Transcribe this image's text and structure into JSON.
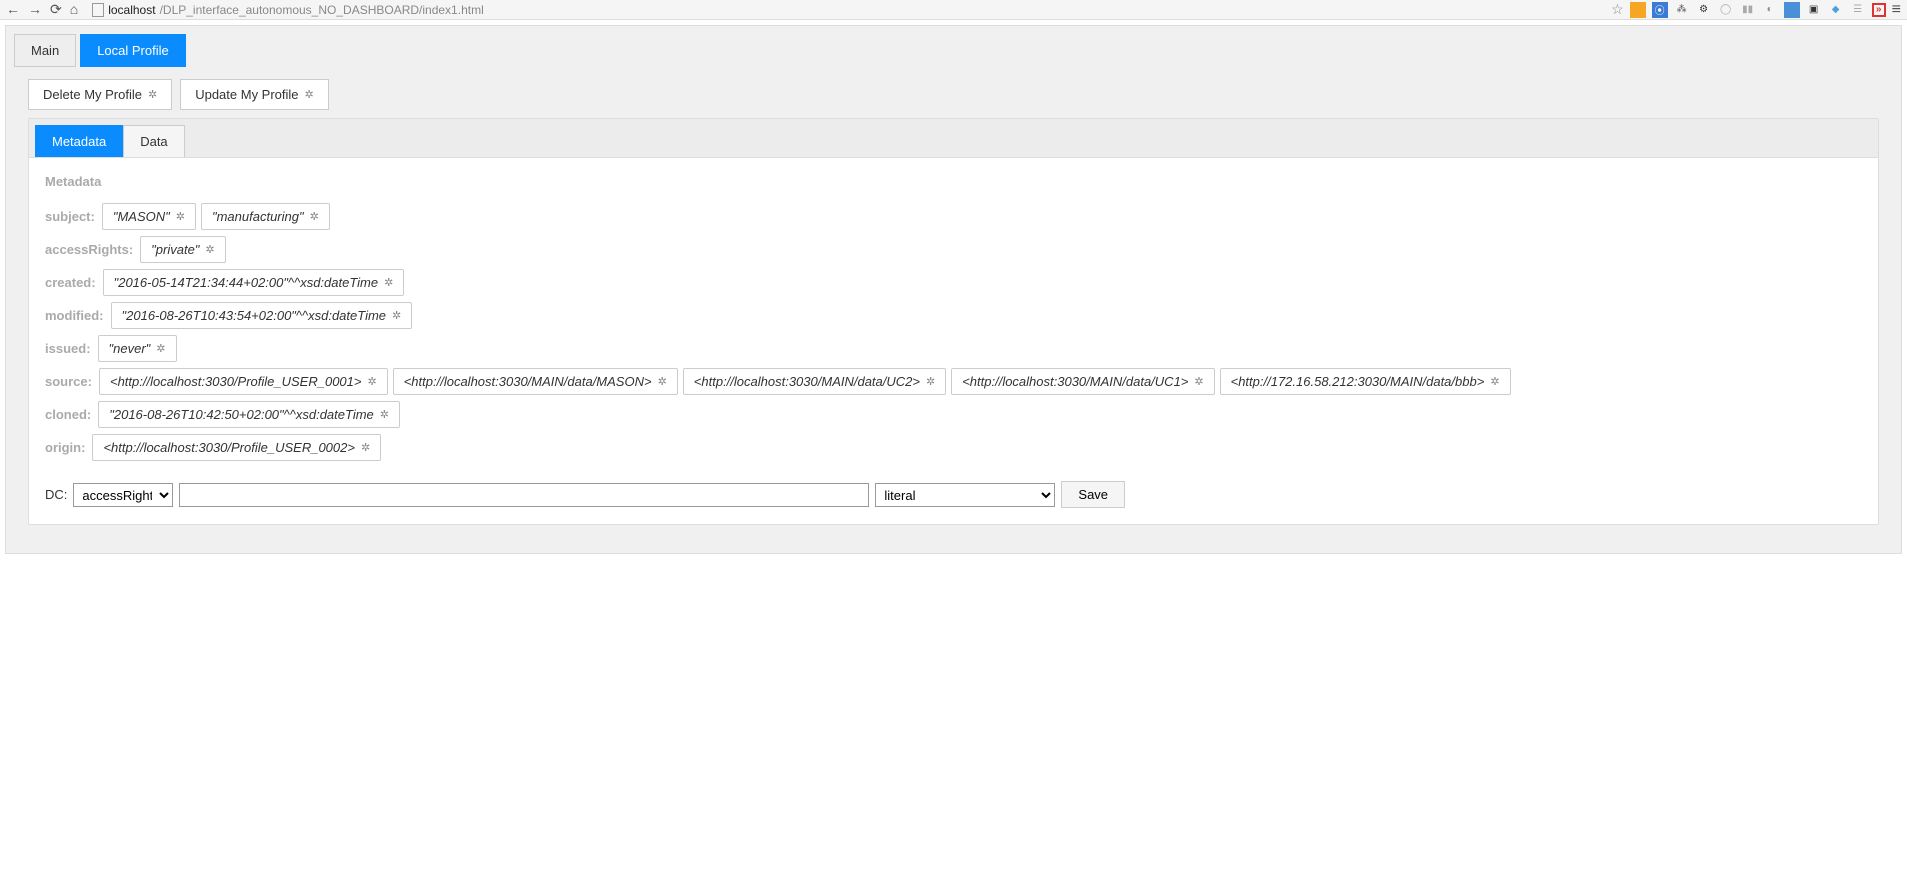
{
  "browser": {
    "url_host": "localhost",
    "url_path": "/DLP_interface_autonomous_NO_DASHBOARD/index1.html"
  },
  "top_tabs": [
    {
      "label": "Main",
      "active": false
    },
    {
      "label": "Local Profile",
      "active": true
    }
  ],
  "actions": {
    "delete": "Delete My Profile",
    "update": "Update My Profile"
  },
  "inner_tabs": [
    {
      "label": "Metadata",
      "active": true
    },
    {
      "label": "Data",
      "active": false
    }
  ],
  "section_title": "Metadata",
  "metadata": [
    {
      "key": "subject",
      "values": [
        "\"MASON\"",
        "\"manufacturing\""
      ]
    },
    {
      "key": "accessRights",
      "values": [
        "\"private\""
      ]
    },
    {
      "key": "created",
      "values": [
        "\"2016-05-14T21:34:44+02:00\"^^xsd:dateTime"
      ]
    },
    {
      "key": "modified",
      "values": [
        "\"2016-08-26T10:43:54+02:00\"^^xsd:dateTime"
      ]
    },
    {
      "key": "issued",
      "values": [
        "\"never\""
      ]
    },
    {
      "key": "source",
      "values": [
        "<http://localhost:3030/Profile_USER_0001>",
        "<http://localhost:3030/MAIN/data/MASON>",
        "<http://localhost:3030/MAIN/data/UC2>",
        "<http://localhost:3030/MAIN/data/UC1>",
        "<http://172.16.58.212:3030/MAIN/data/bbb>"
      ]
    },
    {
      "key": "cloned",
      "values": [
        "\"2016-08-26T10:42:50+02:00\"^^xsd:dateTime"
      ]
    },
    {
      "key": "origin",
      "values": [
        "<http://localhost:3030/Profile_USER_0002>"
      ]
    }
  ],
  "form": {
    "dc_label": "DC",
    "dc_selected": "accessRights",
    "value_input": "",
    "type_selected": "literal",
    "save_label": "Save"
  }
}
